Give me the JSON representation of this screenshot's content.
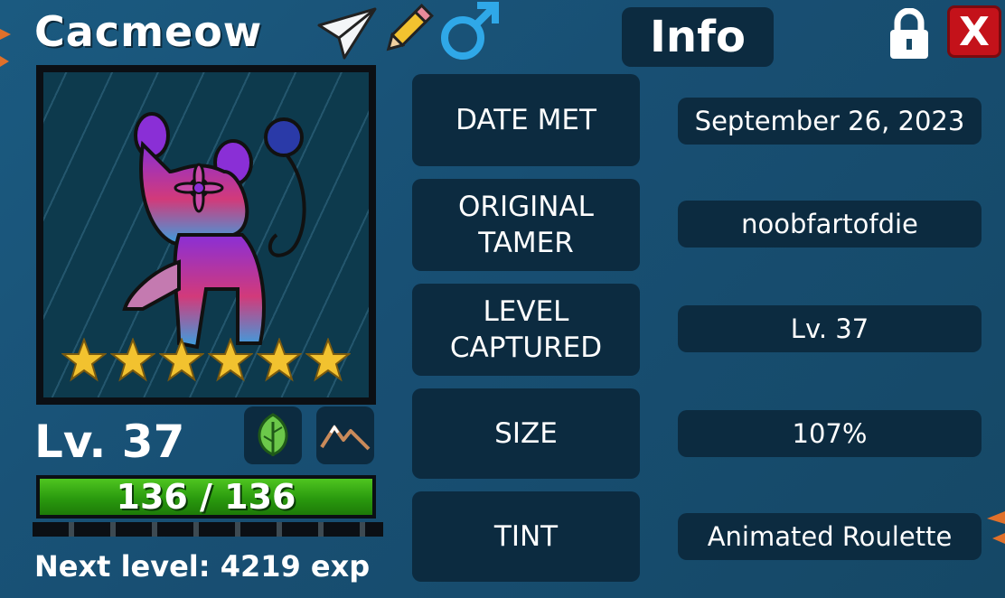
{
  "header": {
    "monster_name": "Cacmeow",
    "tab_label": "Info",
    "close_label": "X",
    "gender": "male"
  },
  "portrait": {
    "star_count": 6,
    "accent_colors": {
      "body_top": "#8a2fd6",
      "body_mid": "#d23a7a",
      "body_bottom": "#3aa0e0",
      "star": "#f2c22f"
    }
  },
  "stats": {
    "level_label": "Lv. 37",
    "hp_text": "136 / 136",
    "hp_fraction": 1.0,
    "next_level_text": "Next level: 4219 exp",
    "type_icons": [
      "leaf-icon",
      "mountain-icon"
    ]
  },
  "info_rows": [
    {
      "label": "DATE MET",
      "value": "September 26, 2023"
    },
    {
      "label": "ORIGINAL\nTAMER",
      "value": "noobfartofdie"
    },
    {
      "label": "LEVEL\nCAPTURED",
      "value": "Lv. 37"
    },
    {
      "label": "SIZE",
      "value": "107%"
    },
    {
      "label": "TINT",
      "value": "Animated Roulette"
    }
  ],
  "colors": {
    "background": "#1b5a80",
    "panel": "#0c2b40",
    "close": "#c4121a",
    "hp": "#2a9a0e",
    "male": "#2fa8e8"
  }
}
